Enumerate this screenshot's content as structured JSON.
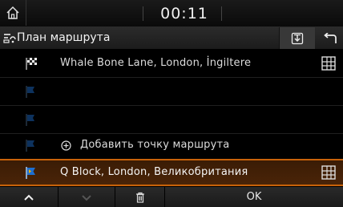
{
  "clock": "00:11",
  "header": {
    "title": "План маршрута",
    "home_icon": "home-icon",
    "route_icon": "route-plan-icon",
    "import_icon": "import-icon",
    "back_icon": "back-icon"
  },
  "route": {
    "destination": {
      "label": "Whale Bone Lane, London, İngiltere",
      "icon": "checkered-flag-icon"
    },
    "waypoints": [
      {
        "label": "",
        "icon": "waypoint-flag-icon"
      },
      {
        "label": "",
        "icon": "waypoint-flag-icon"
      }
    ],
    "add_waypoint": {
      "label": "Добавить точку маршрута",
      "icon": "add-circle-icon"
    },
    "start": {
      "label": "Q Block, London, Великобритания",
      "icon": "start-flag-icon"
    }
  },
  "toolbar": {
    "ok_label": "OK",
    "up_icon": "chevron-up-icon",
    "down_icon": "chevron-down-icon",
    "delete_icon": "trash-icon"
  },
  "colors": {
    "accent": "#c8620a",
    "highlight_bg": "#3a1c05",
    "flag_blue": "#1e6fd0"
  }
}
